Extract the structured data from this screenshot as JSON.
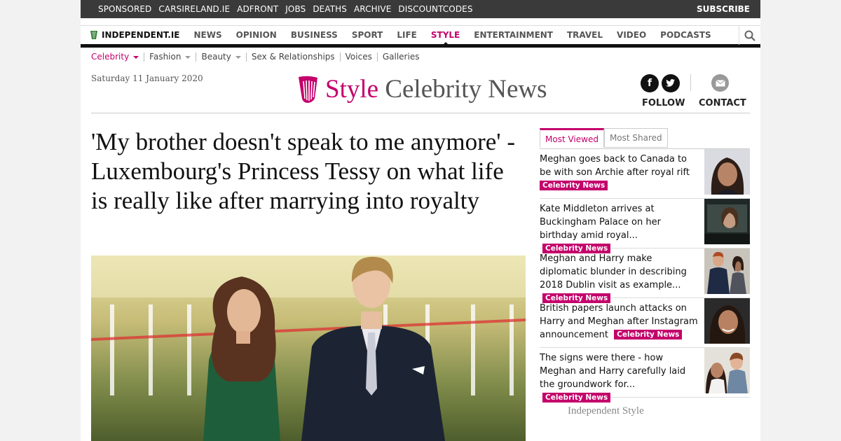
{
  "topbar": {
    "links": [
      "SPONSORED",
      "CARSIRELAND.IE",
      "ADFRONT",
      "JOBS",
      "DEATHS",
      "ARCHIVE",
      "DISCOUNTCODES"
    ],
    "subscribe": "SUBSCRIBE"
  },
  "mainnav": {
    "brand": "INDEPENDENT.IE",
    "items": [
      "NEWS",
      "OPINION",
      "BUSINESS",
      "SPORT",
      "LIFE",
      "STYLE",
      "ENTERTAINMENT",
      "TRAVEL",
      "VIDEO",
      "PODCASTS"
    ],
    "active": "STYLE"
  },
  "subnav": {
    "items": [
      "Celebrity",
      "Fashion",
      "Beauty",
      "Sex & Relationships",
      "Voices",
      "Galleries"
    ]
  },
  "header": {
    "date": "Saturday 11 January 2020",
    "section_word": "Style",
    "section_name": "Celebrity News",
    "follow": "FOLLOW",
    "contact": "CONTACT"
  },
  "article": {
    "headline": "'My brother doesn't speak to me anymore' - Luxembourg's Princess Tessy on what life is really like after marrying into royalty"
  },
  "sidebar": {
    "tabs": [
      "Most Viewed",
      "Most Shared"
    ],
    "stories": [
      {
        "title": "Meghan goes back to Canada to be with son Archie after royal rift",
        "tag": "Celebrity News"
      },
      {
        "title": "Kate Middleton arrives at Buckingham Palace on her birthday amid royal...",
        "tag": "Celebrity News"
      },
      {
        "title": "Meghan and Harry make diplomatic blunder in describing 2018 Dublin visit as example...",
        "tag": "Celebrity News"
      },
      {
        "title": "British papers launch attacks on Harry and Meghan after Instagram announcement",
        "tag": "Celebrity News"
      },
      {
        "title": "The signs were there - how Meghan and Harry carefully laid the groundwork for...",
        "tag": "Celebrity News"
      }
    ],
    "footer": "Independent Style"
  },
  "colors": {
    "accent": "#c4006b",
    "topbar": "#3a3a3a"
  }
}
